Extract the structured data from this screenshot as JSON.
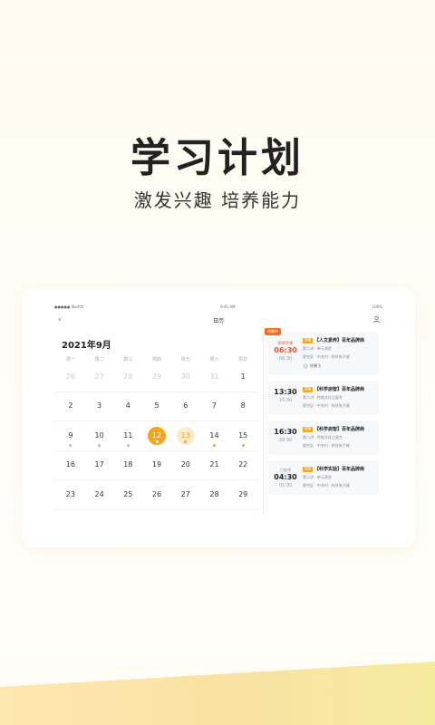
{
  "headline": "学习计划",
  "subline": "激发兴趣  培养能力",
  "tablet": {
    "status": {
      "carrier": "●●●●● Sketch",
      "time": "9:41 AM",
      "battery": "100%"
    },
    "nav": {
      "back": "‹",
      "title": "日历",
      "user_icon": "user-icon"
    },
    "calendar": {
      "month": "2021年9月",
      "weekdays": [
        "周一",
        "周二",
        "周三",
        "周四",
        "周五",
        "周六",
        "周日"
      ],
      "weeks": [
        [
          {
            "d": "26",
            "m": true
          },
          {
            "d": "27",
            "m": true
          },
          {
            "d": "28",
            "m": true
          },
          {
            "d": "29",
            "m": true
          },
          {
            "d": "30",
            "m": true
          },
          {
            "d": "31",
            "m": true
          },
          {
            "d": "1"
          }
        ],
        [
          {
            "d": "2"
          },
          {
            "d": "3"
          },
          {
            "d": "4"
          },
          {
            "d": "5"
          },
          {
            "d": "6"
          },
          {
            "d": "7"
          },
          {
            "d": "8"
          }
        ],
        [
          {
            "d": "9",
            "dot": "gray"
          },
          {
            "d": "10",
            "dot": "gray"
          },
          {
            "d": "11",
            "dot": "gray"
          },
          {
            "d": "12",
            "sel": true,
            "dot": "white"
          },
          {
            "d": "13",
            "soft": true,
            "dot": "orange"
          },
          {
            "d": "14",
            "dot": "orange"
          },
          {
            "d": "15",
            "dot": "orange"
          }
        ],
        [
          {
            "d": "16"
          },
          {
            "d": "17"
          },
          {
            "d": "18"
          },
          {
            "d": "19"
          },
          {
            "d": "20"
          },
          {
            "d": "21"
          },
          {
            "d": "22"
          }
        ],
        [
          {
            "d": "23"
          },
          {
            "d": "24"
          },
          {
            "d": "25"
          },
          {
            "d": "26"
          },
          {
            "d": "27"
          },
          {
            "d": "28"
          },
          {
            "d": "29"
          }
        ]
      ]
    },
    "events": [
      {
        "badge": "直播中",
        "status": "即将开课",
        "start": "06:30",
        "end": "08:30",
        "tag": "直播",
        "title": "【人文素养】百年品牌商",
        "lines": [
          "第二讲 · 单元测验",
          "星空区 · 中关村 · 科技电子城"
        ],
        "teacher": "任晓飞",
        "red": true
      },
      {
        "start": "13:30",
        "end": "15:30",
        "tag": "直播",
        "title": "【科学启智】百年品牌商",
        "lines": [
          "第六讲 · 传统文化之窗专",
          "星空区 · 中关村 · 科技电子城"
        ]
      },
      {
        "start": "16:30",
        "end": "18:30",
        "tag": "直播",
        "title": "【科学启智】百年品牌商",
        "lines": [
          "第六讲 · 传统文化之窗专",
          "星空区 · 中关村 · 科技电子城"
        ]
      },
      {
        "status": "已结束",
        "start": "04:30",
        "end": "05:30",
        "tag": "直播",
        "title": "【科学实验】百年品牌商",
        "lines": [
          "第二讲 · 单元测验",
          "星空区 · 中关村 · 科技电子城"
        ],
        "done": true
      }
    ]
  },
  "colors": {
    "accent": "#f4a41d",
    "live": "#f26b1d",
    "red": "#e8542c"
  }
}
